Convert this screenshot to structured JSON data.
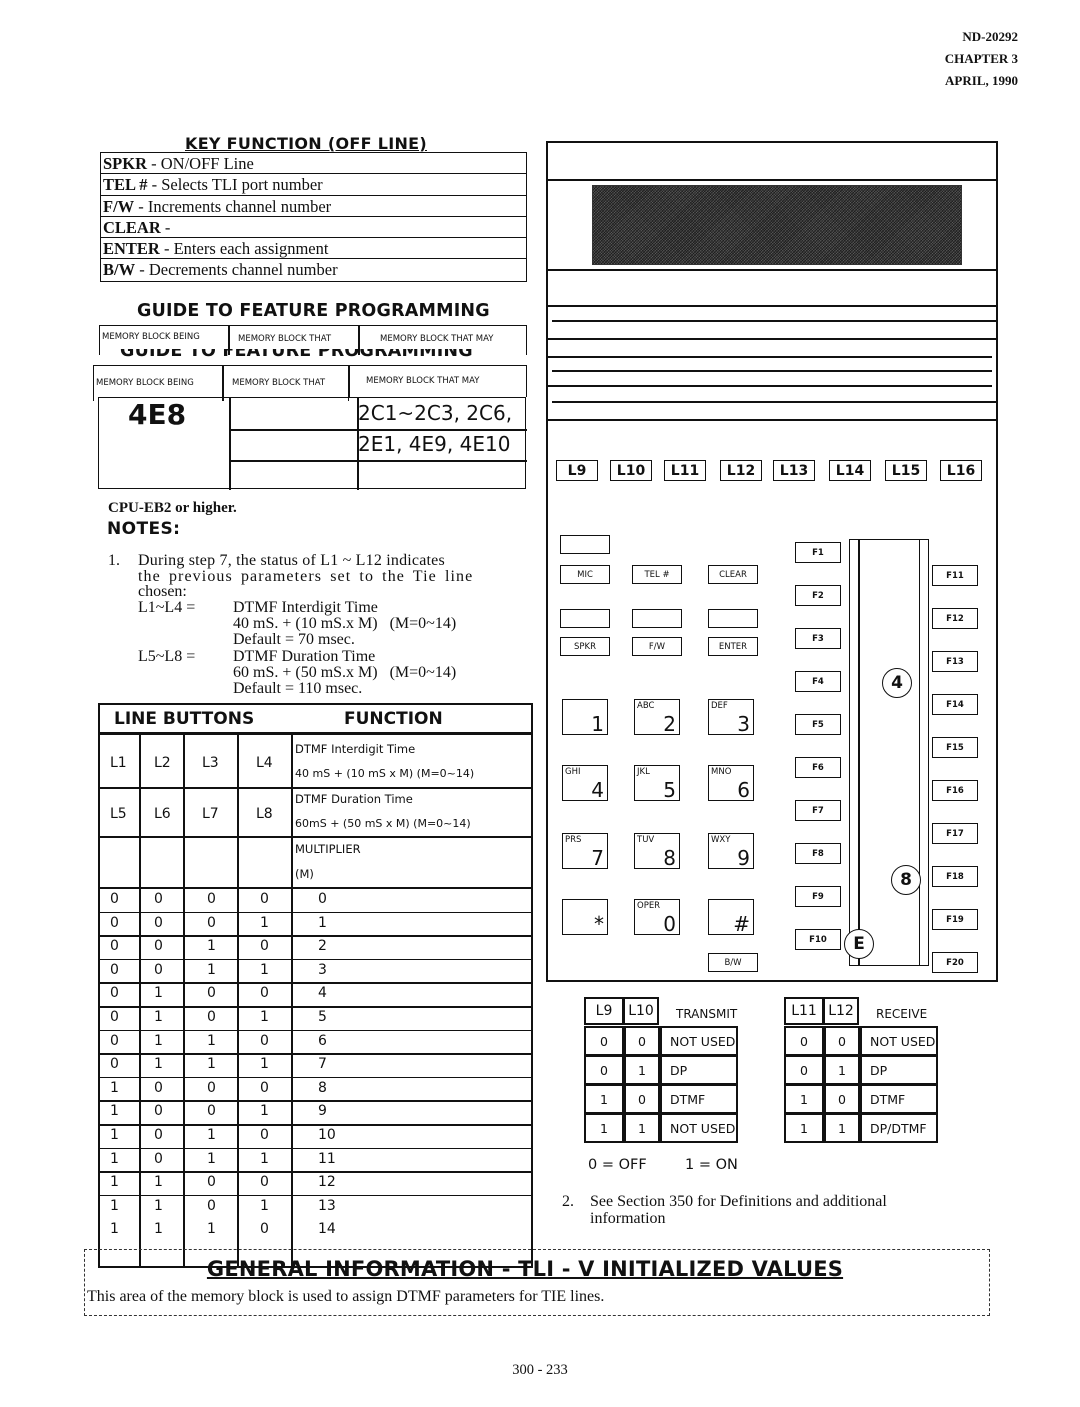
{
  "header": {
    "doc_number": "ND-20292",
    "chapter": "CHAPTER 3",
    "date": "APRIL, 1990"
  },
  "key_function": {
    "title": "KEY FUNCTION (OFF LINE)",
    "rows": [
      {
        "key": "SPKR",
        "desc": " - ON/OFF Line"
      },
      {
        "key": "TEL #",
        "desc": " - Selects TLI port number"
      },
      {
        "key": "F/W",
        "desc": " - Increments channel number"
      },
      {
        "key": "CLEAR",
        "desc": " -"
      },
      {
        "key": "ENTER",
        "desc": " - Enters each assignment"
      },
      {
        "key": "B/W",
        "desc": " - Decrements channel number"
      }
    ]
  },
  "guide": {
    "title": "GUIDE TO FEATURE PROGRAMMING",
    "col_headers": [
      "MEMORY BLOCK BEING",
      "MEMORY BLOCK THAT",
      "MEMORY BLOCK THAT MAY"
    ],
    "memory_block": "4E8",
    "may_affect": [
      "2C1~2C3, 2C6,",
      "2E1, 4E9, 4E10"
    ]
  },
  "notes": {
    "cpu": "CPU-EB2 or higher.",
    "title": "NOTES:",
    "note1_num": "1.",
    "note1_lines": [
      "During step 7, the status of L1 ~ L12 indicates",
      "the previous parameters set to the Tie line",
      "chosen:"
    ],
    "l1_l4_label": "L1~L4 =",
    "l1_l4_lines": [
      "DTMF Interdigit Time",
      "40 mS. + (10 mS.x M)   (M=0~14)",
      "Default = 70 msec."
    ],
    "l5_l8_label": "L5~L8 =",
    "l5_l8_lines": [
      "DTMF Duration Time",
      "60 mS. + (50 mS.x M)   (M=0~14)",
      "Default = 110 msec."
    ],
    "note2_num": "2.",
    "note2_lines": [
      "See Section 350 for Definitions and additional",
      "information"
    ]
  },
  "line_buttons": {
    "header_buttons": "LINE BUTTONS",
    "header_function": "FUNCTION",
    "row1_buttons": [
      "L1",
      "L2",
      "L3",
      "L4"
    ],
    "row1_function": [
      "DTMF Interdigit Time",
      "40 mS + (10 mS x M)  (M=0~14)"
    ],
    "row2_buttons": [
      "L5",
      "L6",
      "L7",
      "L8"
    ],
    "row2_function": [
      "DTMF Duration Time",
      "60mS + (50 mS x M)  (M=0~14)"
    ],
    "row3_function": [
      "MULTIPLIER",
      "(M)"
    ],
    "multiplier_rows": [
      [
        "0",
        "0",
        "0",
        "0",
        "0"
      ],
      [
        "0",
        "0",
        "0",
        "1",
        "1"
      ],
      [
        "0",
        "0",
        "1",
        "0",
        "2"
      ],
      [
        "0",
        "0",
        "1",
        "1",
        "3"
      ],
      [
        "0",
        "1",
        "0",
        "0",
        "4"
      ],
      [
        "0",
        "1",
        "0",
        "1",
        "5"
      ],
      [
        "0",
        "1",
        "1",
        "0",
        "6"
      ],
      [
        "0",
        "1",
        "1",
        "1",
        "7"
      ],
      [
        "1",
        "0",
        "0",
        "0",
        "8"
      ],
      [
        "1",
        "0",
        "0",
        "1",
        "9"
      ],
      [
        "1",
        "0",
        "1",
        "0",
        "10"
      ],
      [
        "1",
        "0",
        "1",
        "1",
        "11"
      ],
      [
        "1",
        "1",
        "0",
        "0",
        "12"
      ],
      [
        "1",
        "1",
        "0",
        "1",
        "13"
      ],
      [
        "1",
        "1",
        "1",
        "0",
        "14"
      ]
    ]
  },
  "phone": {
    "line_keys": [
      "L9",
      "L10",
      "L11",
      "L12",
      "L13",
      "L14",
      "L15",
      "L16"
    ],
    "func_keys_row1": [
      "MIC",
      "TEL #",
      "CLEAR"
    ],
    "func_keys_row2": [
      "SPKR",
      "F/W",
      "ENTER"
    ],
    "dial_keys": [
      {
        "letters": "",
        "num": "1"
      },
      {
        "letters": "ABC",
        "num": "2"
      },
      {
        "letters": "DEF",
        "num": "3"
      },
      {
        "letters": "GHI",
        "num": "4"
      },
      {
        "letters": "JKL",
        "num": "5"
      },
      {
        "letters": "MNO",
        "num": "6"
      },
      {
        "letters": "PRS",
        "num": "7"
      },
      {
        "letters": "TUV",
        "num": "8"
      },
      {
        "letters": "WXY",
        "num": "9"
      },
      {
        "letters": "",
        "num": "*"
      },
      {
        "letters": "OPER",
        "num": "0"
      },
      {
        "letters": "",
        "num": "#"
      }
    ],
    "bw_key": "B/W",
    "f_keys_left": [
      "F1",
      "F2",
      "F3",
      "F4",
      "F5",
      "F6",
      "F7",
      "F8",
      "F9",
      "F10"
    ],
    "f_keys_right": [
      "F11",
      "F12",
      "F13",
      "F14",
      "F15",
      "F16",
      "F17",
      "F18",
      "F19",
      "F20"
    ],
    "step_markers": [
      "4",
      "8",
      "E"
    ]
  },
  "transmit_table": {
    "headers": [
      "L9",
      "L10",
      "TRANSMIT"
    ],
    "rows": [
      [
        "0",
        "0",
        "NOT USED"
      ],
      [
        "0",
        "1",
        "DP"
      ],
      [
        "1",
        "0",
        "DTMF"
      ],
      [
        "1",
        "1",
        "NOT USED"
      ]
    ]
  },
  "receive_table": {
    "headers": [
      "L11",
      "L12",
      "RECEIVE"
    ],
    "rows": [
      [
        "0",
        "0",
        "NOT USED"
      ],
      [
        "0",
        "1",
        "DP"
      ],
      [
        "1",
        "0",
        "DTMF"
      ],
      [
        "1",
        "1",
        "DP/DTMF"
      ]
    ]
  },
  "legend": {
    "off": "0 = OFF",
    "on": "1 = ON"
  },
  "general_info": {
    "title": "GENERAL INFORMATION - TLI - V INITIALIZED VALUES",
    "text": "This area of the memory block is used to assign DTMF parameters for TIE lines."
  },
  "page_number": "300 - 233"
}
